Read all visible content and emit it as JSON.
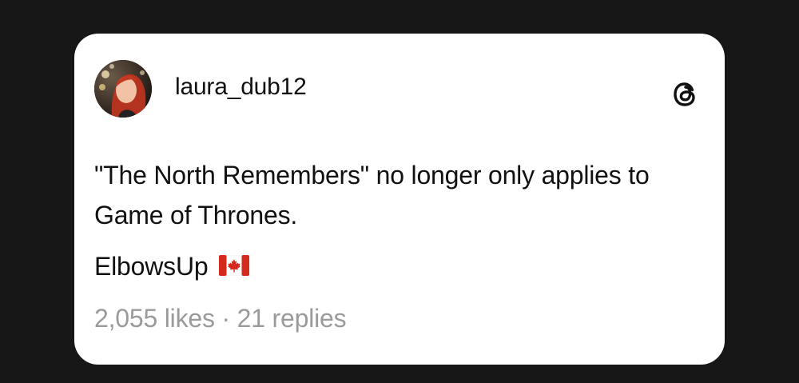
{
  "post": {
    "username": "laura_dub12",
    "text": "\"The North Remembers\" no longer only applies to Game of Thrones.",
    "hashtag": "ElbowsUp",
    "likes": "2,055 likes",
    "separator": "·",
    "replies": "21 replies"
  },
  "icons": {
    "brand": "threads-logo-icon",
    "flag": "canada-flag-icon"
  },
  "colors": {
    "background": "#171717",
    "card": "#ffffff",
    "text": "#111111",
    "muted": "#9a9a9a",
    "flag_red": "#d52b1e"
  }
}
